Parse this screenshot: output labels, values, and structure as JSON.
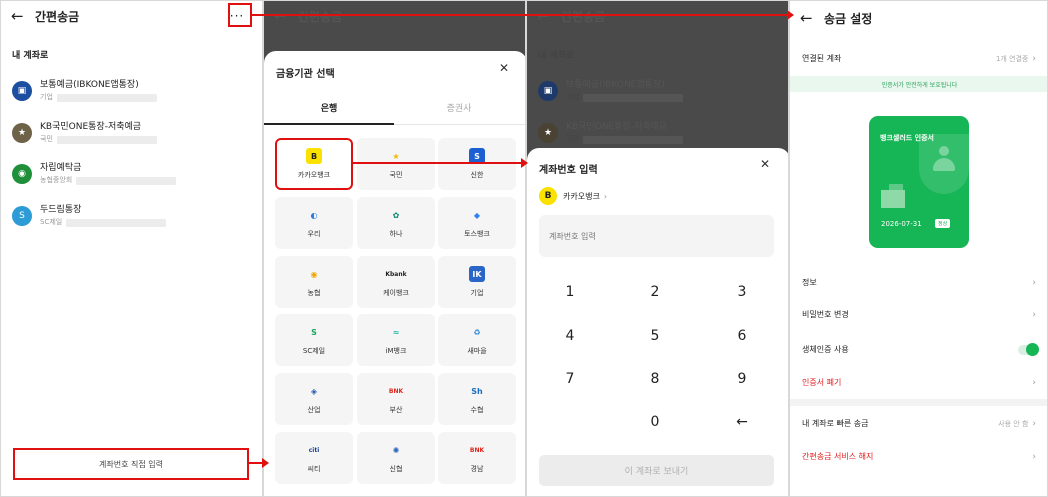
{
  "panel1": {
    "title": "간편송금",
    "menu": "···",
    "section": "내 계좌로",
    "accounts": [
      {
        "name": "보통예금(IBKONE앱통장)",
        "bank": "기업",
        "color": "#1d4fa0",
        "glyph": "▣"
      },
      {
        "name": "KB국민ONE통장-저축예금",
        "bank": "국민",
        "color": "#6e6248",
        "glyph": "★"
      },
      {
        "name": "자립예탁금",
        "bank": "농협중앙회",
        "color": "#1f8f3a",
        "glyph": "◉"
      },
      {
        "name": "두드림통장",
        "bank": "SC제일",
        "color": "#2c9bd6",
        "glyph": "S"
      }
    ],
    "direct_button": "계좌번호 직접 입력"
  },
  "panel2": {
    "bg_title": "간편송금",
    "sheet_title": "금융기관 선택",
    "tabs": [
      "은행",
      "증권사"
    ],
    "banks": [
      {
        "label": "카카오뱅크",
        "logo": "B",
        "bg": "#fae100",
        "fg": "#222"
      },
      {
        "label": "국민",
        "logo": "★",
        "bg": "transparent",
        "fg": "#f2b705"
      },
      {
        "label": "신한",
        "logo": "S",
        "bg": "#1b5fd0",
        "fg": "#fff"
      },
      {
        "label": "우리",
        "logo": "◐",
        "bg": "transparent",
        "fg": "#2a7de1"
      },
      {
        "label": "하나",
        "logo": "✿",
        "bg": "transparent",
        "fg": "#0a8a6e"
      },
      {
        "label": "토스뱅크",
        "logo": "◆",
        "bg": "transparent",
        "fg": "#2f7ff0"
      },
      {
        "label": "농협",
        "logo": "◉",
        "bg": "transparent",
        "fg": "#f0a500"
      },
      {
        "label": "케이뱅크",
        "logo": "Kbank",
        "bg": "transparent",
        "fg": "#222"
      },
      {
        "label": "기업",
        "logo": "IK",
        "bg": "#2a66c8",
        "fg": "#fff"
      },
      {
        "label": "SC제일",
        "logo": "S",
        "bg": "transparent",
        "fg": "#1aa35a"
      },
      {
        "label": "iM뱅크",
        "logo": "≈",
        "bg": "transparent",
        "fg": "#20b8a8"
      },
      {
        "label": "새마을",
        "logo": "♻",
        "bg": "transparent",
        "fg": "#1f7fd6"
      },
      {
        "label": "산업",
        "logo": "◈",
        "bg": "transparent",
        "fg": "#2356b0"
      },
      {
        "label": "부산",
        "logo": "BNK",
        "bg": "transparent",
        "fg": "#e0251b"
      },
      {
        "label": "수협",
        "logo": "Sh",
        "bg": "transparent",
        "fg": "#1a6fc2"
      },
      {
        "label": "씨티",
        "logo": "citi",
        "bg": "transparent",
        "fg": "#1b3f8f"
      },
      {
        "label": "신협",
        "logo": "✺",
        "bg": "transparent",
        "fg": "#2a63b8"
      },
      {
        "label": "경남",
        "logo": "BNK",
        "bg": "transparent",
        "fg": "#e0251b"
      }
    ]
  },
  "panel3": {
    "bg_title": "간편송금",
    "bg_section": "내 계좌로",
    "bg_accounts": [
      {
        "name": "보통예금(IBKONE앱통장)",
        "bank": "기업"
      },
      {
        "name": "KB국민ONE통장-저축예금",
        "bank": "국민"
      }
    ],
    "sheet_title": "계좌번호 입력",
    "selected_bank": "카카오뱅크",
    "input_placeholder": "계좌번호 입력",
    "keys": [
      "1",
      "2",
      "3",
      "4",
      "5",
      "6",
      "7",
      "8",
      "9",
      "",
      "0",
      "←"
    ],
    "send_button": "이 계좌로 보내기"
  },
  "panel4": {
    "title": "송금 설정",
    "linked_label": "연결된 계좌",
    "linked_value": "1개 연결중",
    "banner": "인증서가 안전하게 보호됩니다",
    "cert_title": "뱅크샐러드 인증서",
    "cert_date": "2026-07-31",
    "cert_badge": "정상",
    "rows": [
      {
        "label": "정보",
        "value": ""
      },
      {
        "label": "비밀번호 변경",
        "value": ""
      },
      {
        "label": "생체인증 사용",
        "value": ""
      },
      {
        "label": "인증서 폐기",
        "value": ""
      }
    ],
    "quick_label": "내 계좌로 빠른 송금",
    "quick_value": "사용 안 함",
    "cancel_label": "간편송금 서비스 해지",
    "accent": "#16b556",
    "danger": "#e02020"
  }
}
